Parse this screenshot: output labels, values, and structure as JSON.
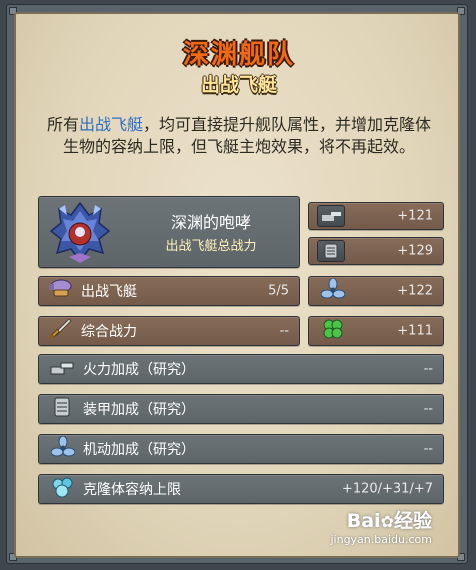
{
  "header": {
    "title": "深渊舰队",
    "subtitle": "出战飞艇"
  },
  "description": {
    "prefix": "所有",
    "highlight": "出战飞艇",
    "rest": "，均可直接提升舰队属性，并增加克隆体生物的容纳上限，但飞艇主炮效果，将不再起效。"
  },
  "featured_ship": {
    "name": "深渊的咆哮",
    "caption": "出战飞艇总战力"
  },
  "left_rows": [
    {
      "label": "出战飞艇",
      "value": "5/5",
      "icon": "airship-icon"
    },
    {
      "label": "综合战力",
      "value": "--",
      "icon": "sword-icon"
    }
  ],
  "right_stats": [
    {
      "value": "+121",
      "icon": "cannon-icon"
    },
    {
      "value": "+129",
      "icon": "armor-plate-icon"
    },
    {
      "value": "+122",
      "icon": "propeller-icon"
    },
    {
      "value": "+111",
      "icon": "clover-icon"
    }
  ],
  "research_rows": [
    {
      "label": "火力加成（研究）",
      "value": "--",
      "icon": "cannon-icon"
    },
    {
      "label": "装甲加成（研究）",
      "value": "--",
      "icon": "armor-plate-icon"
    },
    {
      "label": "机动加成（研究）",
      "value": "--",
      "icon": "propeller-icon"
    }
  ],
  "clone_row": {
    "label": "克隆体容纳上限",
    "value": "+120/+31/+7",
    "icon": "clone-creature-icon"
  },
  "watermark": {
    "brand_left": "Bai",
    "brand_right": "经验",
    "url": "jingyan.baidu.com"
  },
  "colors": {
    "title": "#f06a16",
    "subtitle": "#ffe59a",
    "highlight": "#2f6fc4",
    "brown_panel": "#7d6251",
    "dark_panel": "#656c70"
  }
}
